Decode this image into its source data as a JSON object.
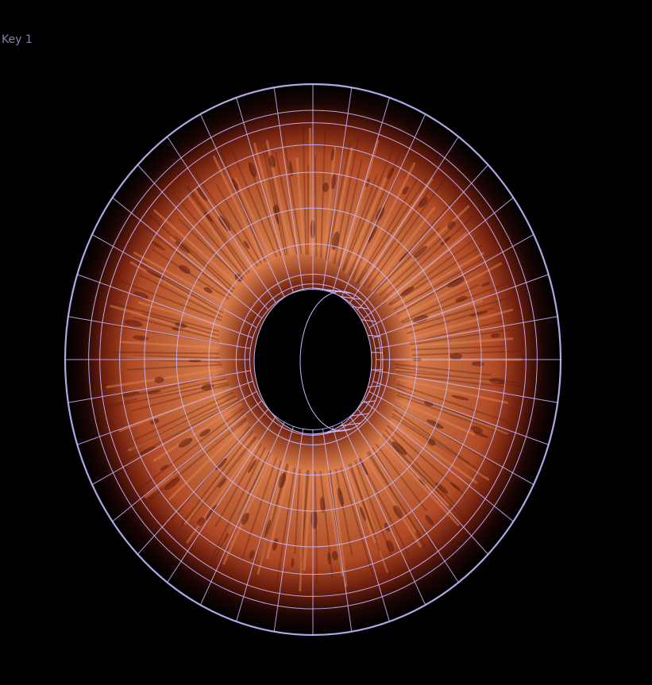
{
  "viewport": {
    "key_label": "Key 1"
  },
  "colors": {
    "background": "#000000",
    "wireframe": "#c6b8ff",
    "iris_light": "#e08a5a",
    "iris_mid": "#b9542c",
    "iris_dark": "#5a1a0c",
    "limbal_ring": "#1a0604",
    "label": "#8a7fae"
  },
  "mesh": {
    "object": "iris",
    "display": "wireframe-over-shaded",
    "radial_segments": 40,
    "ring_loops": 8
  }
}
